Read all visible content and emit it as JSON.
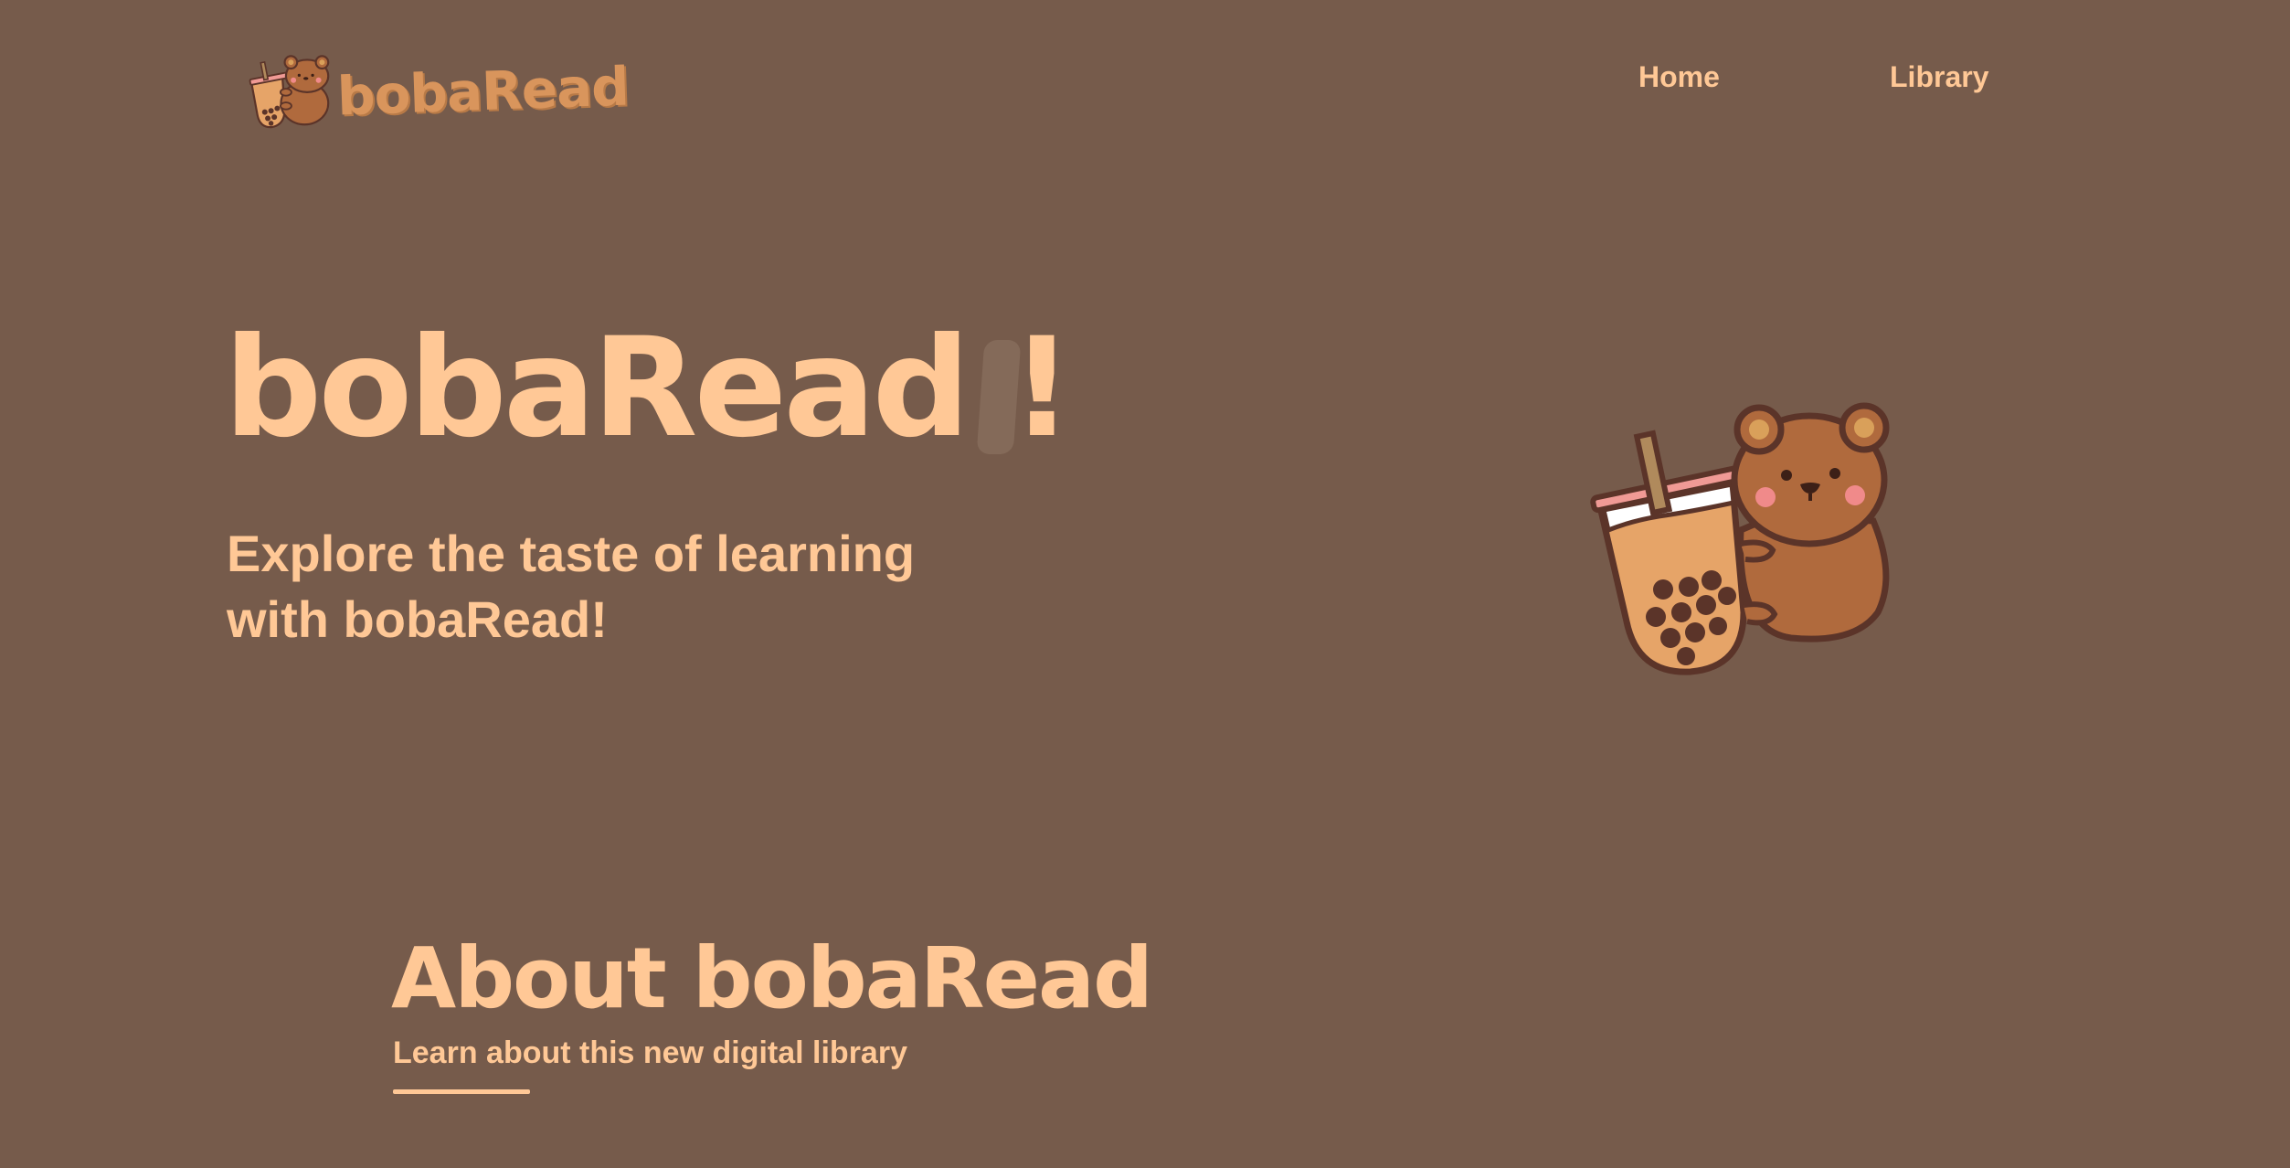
{
  "header": {
    "logo_text": "bobaRead",
    "logo_icon": "boba-bear-icon",
    "nav": [
      {
        "label": "Home"
      },
      {
        "label": "Library"
      }
    ]
  },
  "hero": {
    "title": "bobaRead !",
    "subtitle_line1": "Explore the taste of learning",
    "subtitle_line2": "with bobaRead!",
    "mascot_icon": "boba-bear-icon"
  },
  "about": {
    "title": "About bobaRead",
    "subtitle": "Learn about this new digital library"
  },
  "colors": {
    "background": "#765b4b",
    "text": "#ffc896",
    "logo_text": "#d9955c"
  }
}
